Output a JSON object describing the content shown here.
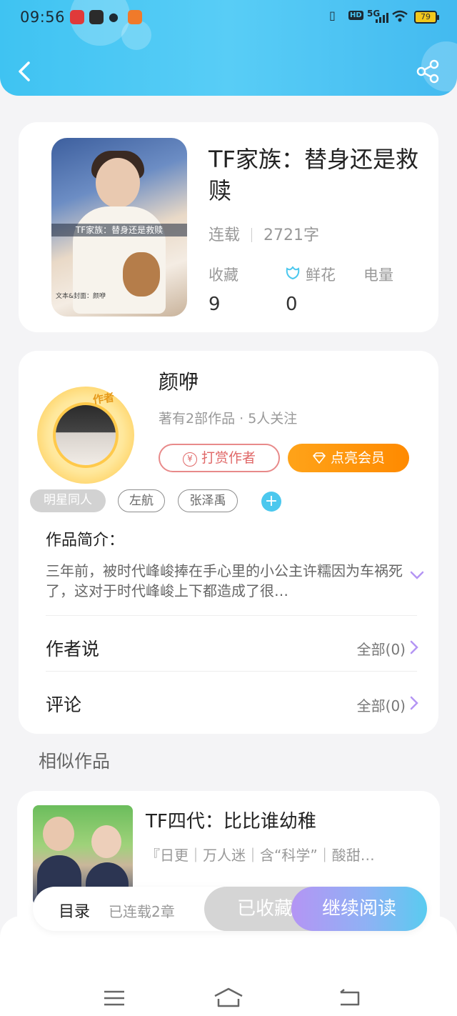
{
  "status_bar": {
    "time": "09:56",
    "network": "5G",
    "hd": "HD",
    "battery": "79"
  },
  "book": {
    "title": "TF家族：替身还是救赎",
    "status": "连载",
    "word_count": "2721字",
    "cover_band": "TF家族：替身还是救赎",
    "cover_credit": "文本&封面：颜咿",
    "stats": [
      {
        "label": "收藏",
        "value": "9"
      },
      {
        "label": "鲜花",
        "value": "0"
      },
      {
        "label": "电量",
        "value": ""
      }
    ]
  },
  "author": {
    "badge": "作者",
    "name": "颜咿",
    "stats": "著有2部作品 · 5人关注",
    "tip_button": "打赏作者",
    "tip_symbol": "¥",
    "vip_button": "点亮会员",
    "tags": [
      "明星同人",
      "左航",
      "张泽禹"
    ],
    "add_tag": "+",
    "intro_title": "作品简介：",
    "intro_text": "三年前，被时代峰峻捧在手心里的小公主许糯因为车祸死了，这对于时代峰峻上下都造成了很…",
    "author_says": "作者说",
    "author_says_right": "全部(0)",
    "comments": "评论",
    "comments_right": "全部(0)"
  },
  "similar": {
    "heading": "相似作品",
    "items": [
      {
        "title": "TF四代：比比谁幼稚",
        "desc": "『日更｜万人迷｜含“科学”｜酸甜…"
      }
    ]
  },
  "action_bar": {
    "toc": "目录",
    "chapters": "已连载2章",
    "collected": "已收藏",
    "continue": "继续阅读"
  },
  "colors": {
    "header": "#4cc6f3",
    "vip": "#ff9410",
    "tip": "#e06868",
    "accent_purple": "#b495f4"
  }
}
